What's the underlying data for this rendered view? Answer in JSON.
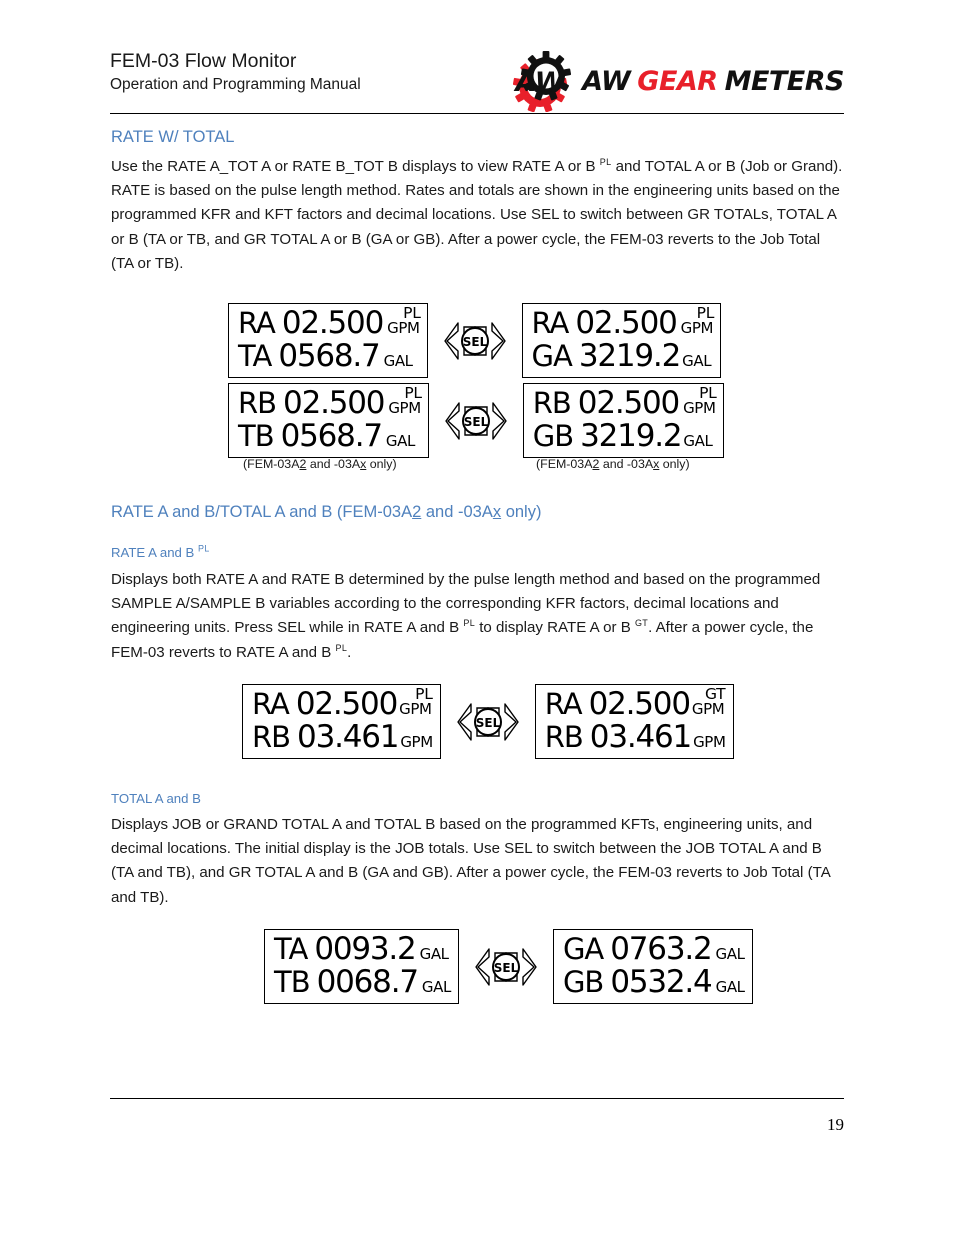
{
  "header": {
    "doc_title": "FEM-03 Flow Monitor",
    "doc_subtitle": "Operation and Programming Manual",
    "logo": {
      "word_1": "AW",
      "word_2": "GEAR",
      "word_3": "METERS",
      "mark_letters": "AW",
      "accent_color": "#e8202a",
      "dark_color": "#111111"
    }
  },
  "sections": {
    "rate_w_total": {
      "heading": "RATE W/ TOTAL",
      "paragraph_part_1": "Use the RATE A_TOT A or RATE B_TOT B displays to view RATE A or B ",
      "paragraph_sup_1": "PL",
      "paragraph_part_2": " and TOTAL A or B (Job or Grand). RATE is based on the pulse length method. Rates and totals are shown in the engineering units based on the programmed KFR and KFT factors and decimal locations. Use SEL to switch between GR TOTALs, TOTAL A or B (TA or TB, and GR TOTAL A or B (GA or GB). After a power cycle, the FEM-03 reverts to the Job Total (TA or TB)."
    },
    "rate_ab_total_ab": {
      "heading_part_1": "RATE A and B/TOTAL A and B (FEM-03A",
      "heading_u_1": "2",
      "heading_part_2": " and -03A",
      "heading_u_2": "x",
      "heading_part_3": " only)"
    },
    "rate_a_and_b": {
      "subheading_text": "RATE A and B ",
      "subheading_sup": "PL",
      "paragraph_part_1": "Displays both RATE A and RATE B determined by the pulse length method and based on the programmed SAMPLE A/SAMPLE B variables according to the corresponding KFR factors, decimal locations and engineering units. Press SEL while in RATE A and B ",
      "paragraph_sup_1": "PL",
      "paragraph_part_2": " to display RATE A or B ",
      "paragraph_sup_2": "GT",
      "paragraph_part_3": ".  After a power cycle, the FEM-03 reverts to RATE A and B ",
      "paragraph_sup_3": "PL",
      "paragraph_part_4": "."
    },
    "total_a_and_b": {
      "subheading": "TOTAL A and B",
      "paragraph": "Displays JOB or GRAND TOTAL A and TOTAL B based on the programmed KFTs, engineering units, and decimal locations. The initial display is the JOB totals. Use SEL to switch between the JOB TOTAL A and B (TA and TB), and GR TOTAL A and B (GA and GB). After a power cycle, the FEM-03 reverts to Job Total (TA and TB)."
    }
  },
  "sel_control": {
    "label": "SEL"
  },
  "displays": {
    "group_1": {
      "left": {
        "line_1": {
          "label": "RA",
          "value": "02.500",
          "unit": "GPM",
          "sup": "PL"
        },
        "line_2": {
          "label": "TA",
          "value": "0568.7",
          "unit": "GAL",
          "sup": ""
        }
      },
      "right": {
        "line_1": {
          "label": "RA",
          "value": "02.500",
          "unit": "GPM",
          "sup": "PL"
        },
        "line_2": {
          "label": "GA",
          "value": "3219.2",
          "unit": "GAL",
          "sup": ""
        }
      }
    },
    "group_2": {
      "left": {
        "line_1": {
          "label": "RB",
          "value": "02.500",
          "unit": "GPM",
          "sup": "PL"
        },
        "line_2": {
          "label": "TB",
          "value": "0568.7",
          "unit": "GAL",
          "sup": ""
        }
      },
      "right": {
        "line_1": {
          "label": "RB",
          "value": "02.500",
          "unit": "GPM",
          "sup": "PL"
        },
        "line_2": {
          "label": "GB",
          "value": "3219.2",
          "unit": "GAL",
          "sup": ""
        }
      },
      "caption_left_part_1": "(FEM-03A",
      "caption_left_u_1": "2",
      "caption_left_part_2": " and -03A",
      "caption_left_u_2": "x",
      "caption_left_part_3": " only)",
      "caption_right_part_1": "(FEM-03A",
      "caption_right_u_1": "2",
      "caption_right_part_2": " and -03A",
      "caption_right_u_2": "x",
      "caption_right_part_3": " only)"
    },
    "group_3": {
      "left": {
        "line_1": {
          "label": "RA",
          "value": "02.500",
          "unit": "GPM",
          "sup": "PL"
        },
        "line_2": {
          "label": "RB",
          "value": "03.461",
          "unit": "GPM",
          "sup": ""
        }
      },
      "right": {
        "line_1": {
          "label": "RA",
          "value": "02.500",
          "unit": "GPM",
          "sup": "GT"
        },
        "line_2": {
          "label": "RB",
          "value": "03.461",
          "unit": "GPM",
          "sup": ""
        }
      }
    },
    "group_4": {
      "left": {
        "line_1": {
          "label": "TA",
          "value": "0093.2",
          "unit": "GAL",
          "sup": ""
        },
        "line_2": {
          "label": "TB",
          "value": "0068.7",
          "unit": "GAL",
          "sup": ""
        }
      },
      "right": {
        "line_1": {
          "label": "GA",
          "value": "0763.2",
          "unit": "GAL",
          "sup": ""
        },
        "line_2": {
          "label": "GB",
          "value": "0532.4",
          "unit": "GAL",
          "sup": ""
        }
      }
    }
  },
  "footer": {
    "page_number": "19"
  }
}
